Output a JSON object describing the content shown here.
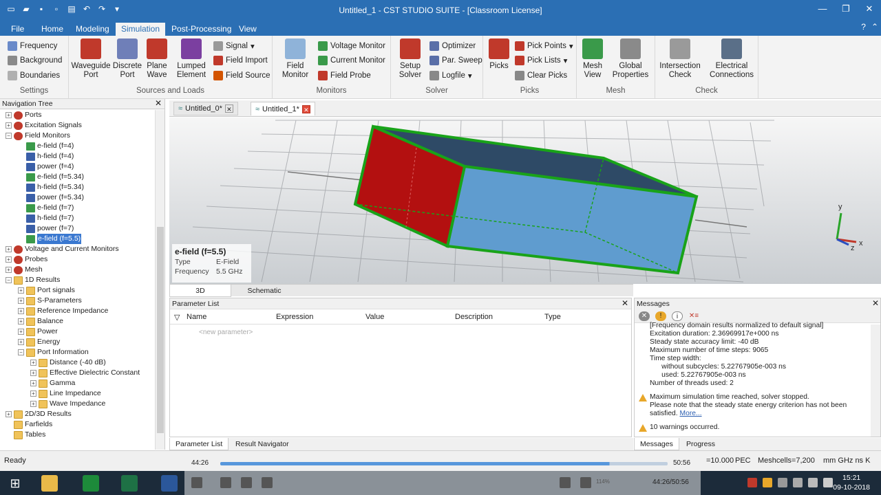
{
  "window": {
    "title": "Untitled_1 - CST STUDIO SUITE - [Classroom License]"
  },
  "ribbon_tabs": [
    {
      "label": "File"
    },
    {
      "label": "Home"
    },
    {
      "label": "Modeling"
    },
    {
      "label": "Simulation",
      "active": true
    },
    {
      "label": "Post-Processing"
    },
    {
      "label": "View"
    }
  ],
  "ribbon": {
    "settings": {
      "frequency": "Frequency",
      "background": "Background",
      "boundaries": "Boundaries",
      "label": "Settings"
    },
    "sources": {
      "waveguide_port": "Waveguide Port",
      "discrete_port": "Discrete Port",
      "plane_wave": "Plane Wave",
      "lumped_element": "Lumped Element",
      "signal": "Signal",
      "field_import": "Field Import",
      "field_source": "Field Source",
      "label": "Sources and Loads"
    },
    "monitors": {
      "field_monitor": "Field Monitor",
      "voltage_monitor": "Voltage Monitor",
      "current_monitor": "Current Monitor",
      "field_probe": "Field Probe",
      "label": "Monitors"
    },
    "solver": {
      "setup_solver": "Setup Solver",
      "optimizer": "Optimizer",
      "par_sweep": "Par. Sweep",
      "logfile": "Logfile",
      "label": "Solver"
    },
    "picks": {
      "picks": "Picks",
      "pick_points": "Pick Points",
      "pick_lists": "Pick Lists",
      "clear_picks": "Clear Picks",
      "label": "Picks"
    },
    "mesh": {
      "mesh_view": "Mesh View",
      "global_properties": "Global Properties",
      "label": "Mesh"
    },
    "check": {
      "intersection_check": "Intersection Check",
      "electrical_connections": "Electrical Connections",
      "label": "Check"
    }
  },
  "navtree": {
    "header": "Navigation Tree",
    "items": [
      {
        "label": "Ports",
        "level": 0,
        "icon": "red",
        "pm": "+"
      },
      {
        "label": "Excitation Signals",
        "level": 0,
        "icon": "red",
        "pm": "+"
      },
      {
        "label": "Field Monitors",
        "level": 0,
        "icon": "red",
        "pm": "−"
      },
      {
        "label": "e-field (f=4)",
        "level": 1,
        "icon": "green"
      },
      {
        "label": "h-field (f=4)",
        "level": 1,
        "icon": "blue"
      },
      {
        "label": "power (f=4)",
        "level": 1,
        "icon": "blue"
      },
      {
        "label": "e-field (f=5.34)",
        "level": 1,
        "icon": "green"
      },
      {
        "label": "h-field (f=5.34)",
        "level": 1,
        "icon": "blue"
      },
      {
        "label": "power (f=5.34)",
        "level": 1,
        "icon": "blue"
      },
      {
        "label": "e-field (f=7)",
        "level": 1,
        "icon": "green"
      },
      {
        "label": "h-field (f=7)",
        "level": 1,
        "icon": "blue"
      },
      {
        "label": "power (f=7)",
        "level": 1,
        "icon": "blue"
      },
      {
        "label": "e-field (f=5.5)",
        "level": 1,
        "icon": "green",
        "selected": true
      },
      {
        "label": "Voltage and Current Monitors",
        "level": 0,
        "icon": "red",
        "pm": "+"
      },
      {
        "label": "Probes",
        "level": 0,
        "icon": "red",
        "pm": "+"
      },
      {
        "label": "Mesh",
        "level": 0,
        "icon": "red",
        "pm": "+"
      },
      {
        "label": "1D Results",
        "level": 0,
        "icon": "folder",
        "pm": "−"
      },
      {
        "label": "Port signals",
        "level": 1,
        "icon": "folder",
        "pm": "+"
      },
      {
        "label": "S-Parameters",
        "level": 1,
        "icon": "folder",
        "pm": "+"
      },
      {
        "label": "Reference Impedance",
        "level": 1,
        "icon": "folder",
        "pm": "+"
      },
      {
        "label": "Balance",
        "level": 1,
        "icon": "folder",
        "pm": "+"
      },
      {
        "label": "Power",
        "level": 1,
        "icon": "folder",
        "pm": "+"
      },
      {
        "label": "Energy",
        "level": 1,
        "icon": "folder",
        "pm": "+"
      },
      {
        "label": "Port Information",
        "level": 1,
        "icon": "folder",
        "pm": "−"
      },
      {
        "label": "Distance (-40 dB)",
        "level": 2,
        "icon": "folder",
        "pm": "+"
      },
      {
        "label": "Effective Dielectric Constant",
        "level": 2,
        "icon": "folder",
        "pm": "+"
      },
      {
        "label": "Gamma",
        "level": 2,
        "icon": "folder",
        "pm": "+"
      },
      {
        "label": "Line Impedance",
        "level": 2,
        "icon": "folder",
        "pm": "+"
      },
      {
        "label": "Wave Impedance",
        "level": 2,
        "icon": "folder",
        "pm": "+"
      },
      {
        "label": "2D/3D Results",
        "level": 0,
        "icon": "folder",
        "pm": "+"
      },
      {
        "label": "Farfields",
        "level": 0,
        "icon": "folder"
      },
      {
        "label": "Tables",
        "level": 0,
        "icon": "folder"
      }
    ]
  },
  "doc_tabs": [
    {
      "label": "Untitled_0*"
    },
    {
      "label": "Untitled_1*",
      "active": true
    }
  ],
  "viewport": {
    "info_title": "e-field (f=5.5)",
    "type_label": "Type",
    "type_value": "E-Field",
    "freq_label": "Frequency",
    "freq_value": "5.5 GHz",
    "axis_y": "y",
    "axis_x": "x",
    "axis_z": "z"
  },
  "view_tabs": [
    {
      "label": "3D",
      "active": true
    },
    {
      "label": "Schematic"
    }
  ],
  "param_list": {
    "header": "Parameter List",
    "columns": [
      "Name",
      "Expression",
      "Value",
      "Description",
      "Type"
    ],
    "placeholder": "<new parameter>"
  },
  "bottom_tabs": [
    {
      "label": "Parameter List",
      "active": true
    },
    {
      "label": "Result Navigator"
    }
  ],
  "messages": {
    "header": "Messages",
    "lines": [
      "[Frequency domain results normalized to default signal]",
      "Excitation duration: 2.36969917e+000 ns",
      "Steady state accuracy limit: -40 dB",
      "Maximum number of time steps: 9065",
      "Time step width:",
      "      without subcycles: 5.22767905e-003 ns",
      "      used: 5.22767905e-003 ns",
      "Number of threads used: 2"
    ],
    "warning1_line1": "Maximum simulation time reached, solver stopped.",
    "warning1_line2": "Please note that the steady state energy criterion has not been",
    "warning1_line3": "satisfied.",
    "more_link": "More...",
    "warning2": "10 warnings occurred."
  },
  "msg_tabs": [
    {
      "label": "Messages",
      "active": true
    },
    {
      "label": "Progress"
    }
  ],
  "statusbar": {
    "ready": "Ready",
    "raster": "=10.000",
    "pec": "PEC",
    "meshcells": "Meshcells=7,200",
    "units": "mm  GHz  ns  K"
  },
  "video": {
    "current": "44:26",
    "total": "50:56",
    "combined": "44:26/50:56",
    "volume": "114%",
    "progress": 0.87
  },
  "taskbar": {
    "time": "15:21",
    "date": "09-10-2018"
  }
}
